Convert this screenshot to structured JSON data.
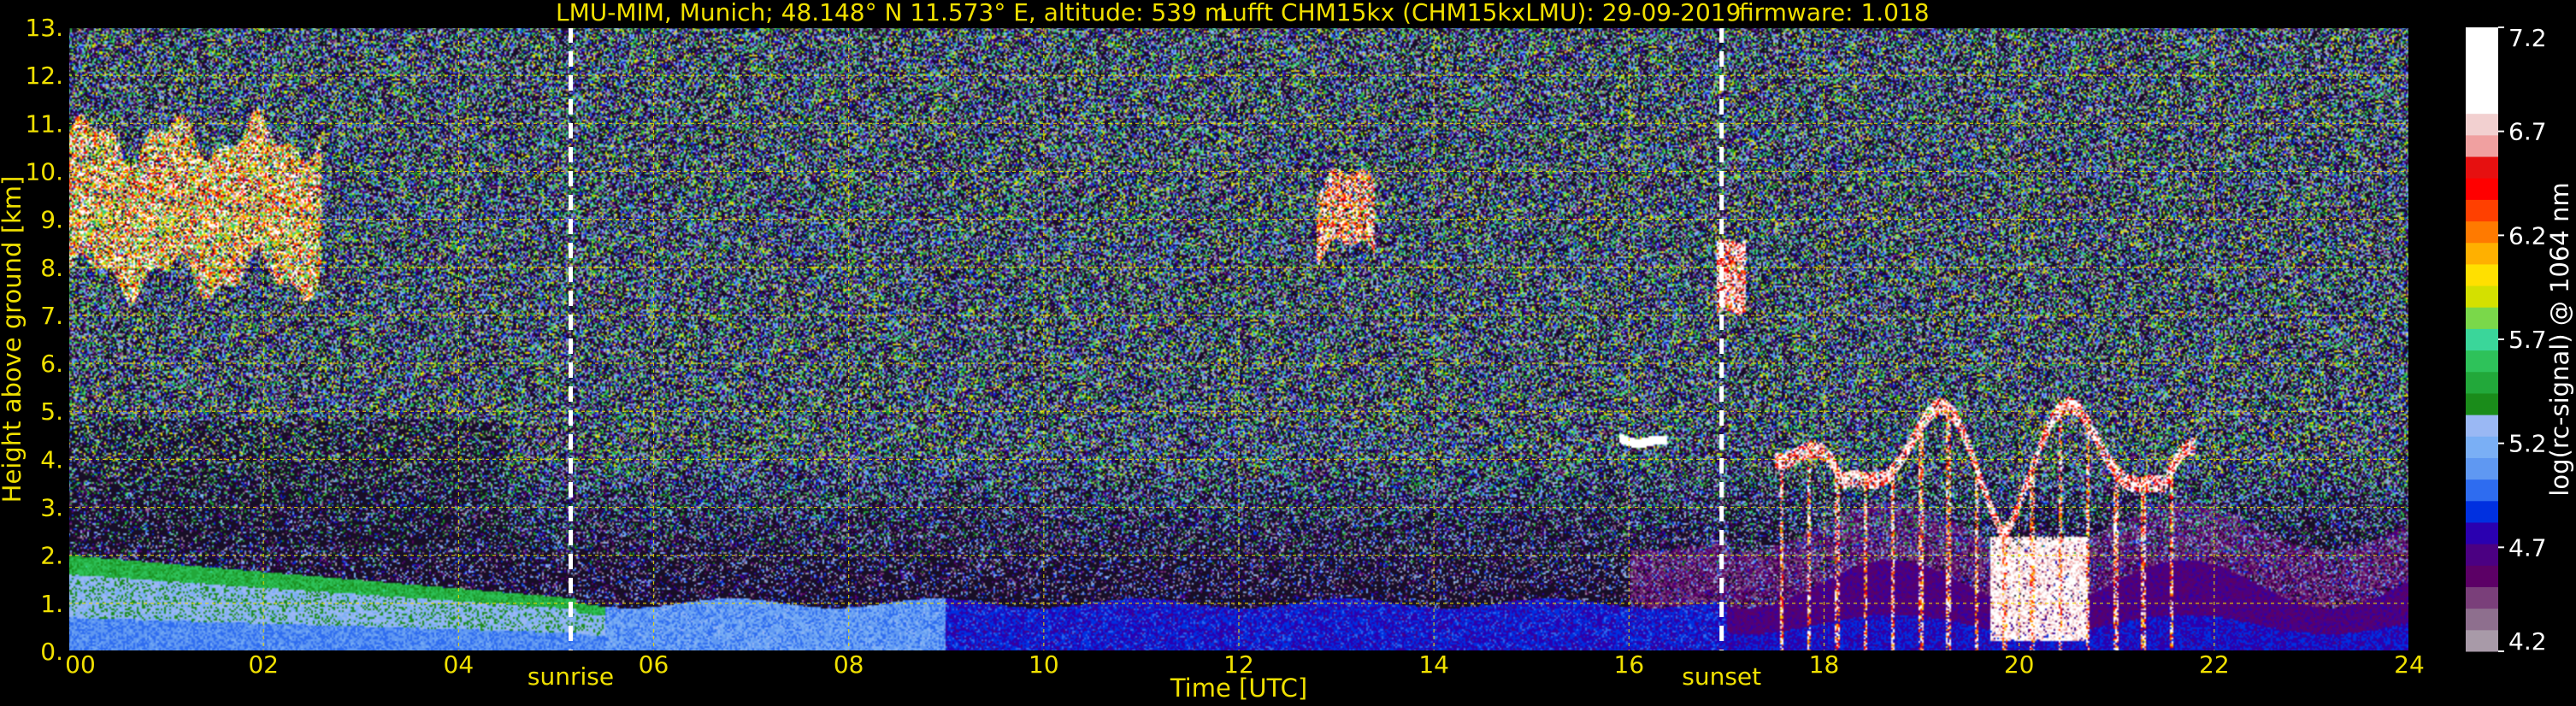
{
  "chart_data": {
    "type": "heatmap",
    "title": {
      "station": "LMU-MIM, Munich; 48.148° N 11.573° E, altitude: 539 m",
      "instrument": "Lufft CHM15kx (CHM15kxLMU): 29-09-2019",
      "firmware": "firmware: 1.018"
    },
    "xlabel": "Time [UTC]",
    "ylabel": "Height above ground [km]",
    "xlim": [
      0,
      24
    ],
    "ylim": [
      0,
      13
    ],
    "xticks": [
      {
        "value": 0,
        "label": "00"
      },
      {
        "value": 2,
        "label": "02"
      },
      {
        "value": 4,
        "label": "04"
      },
      {
        "value": 6,
        "label": "06"
      },
      {
        "value": 8,
        "label": "08"
      },
      {
        "value": 10,
        "label": "10"
      },
      {
        "value": 12,
        "label": "12"
      },
      {
        "value": 14,
        "label": "14"
      },
      {
        "value": 16,
        "label": "16"
      },
      {
        "value": 18,
        "label": "18"
      },
      {
        "value": 20,
        "label": "20"
      },
      {
        "value": 22,
        "label": "22"
      },
      {
        "value": 24,
        "label": "24"
      }
    ],
    "yticks": [
      {
        "value": 0,
        "label": "0."
      },
      {
        "value": 1,
        "label": "1."
      },
      {
        "value": 2,
        "label": "2."
      },
      {
        "value": 3,
        "label": "3."
      },
      {
        "value": 4,
        "label": "4."
      },
      {
        "value": 5,
        "label": "5."
      },
      {
        "value": 6,
        "label": "6."
      },
      {
        "value": 7,
        "label": "7."
      },
      {
        "value": 8,
        "label": "8."
      },
      {
        "value": 9,
        "label": "9."
      },
      {
        "value": 10,
        "label": "10."
      },
      {
        "value": 11,
        "label": "11."
      },
      {
        "value": 12,
        "label": "12."
      },
      {
        "value": 13,
        "label": "13."
      }
    ],
    "grid": true,
    "grid_color": "#f0e000",
    "events": [
      {
        "name": "sunrise",
        "time": 5.15
      },
      {
        "name": "sunset",
        "time": 16.95
      }
    ],
    "colorbar": {
      "label": "log(rc-signal) @ 1064 nm",
      "range": [
        4.2,
        7.2
      ],
      "ticks": [
        {
          "value": 4.2,
          "label": "4.2"
        },
        {
          "value": 4.7,
          "label": "4.7"
        },
        {
          "value": 5.2,
          "label": "5.2"
        },
        {
          "value": 5.7,
          "label": "5.7"
        },
        {
          "value": 6.2,
          "label": "6.2"
        },
        {
          "value": 6.7,
          "label": "6.7"
        },
        {
          "value": 7.2,
          "label": "7.2"
        }
      ],
      "colors": [
        "#a89aa8",
        "#8e6f8e",
        "#7a3f7a",
        "#5c0066",
        "#4b0082",
        "#2a00b0",
        "#0030e0",
        "#2e6cf0",
        "#5f98f2",
        "#7aaff5",
        "#9ab8f4",
        "#1a8c1a",
        "#22a83a",
        "#2ec25a",
        "#3ad69a",
        "#7ad84a",
        "#d4e000",
        "#ffe000",
        "#ffb000",
        "#ff7a00",
        "#ff4000",
        "#ff0000",
        "#e61010",
        "#f0a0a0",
        "#f2d0d0",
        "#ffffff",
        "#ffffff",
        "#ffffff",
        "#ffffff"
      ]
    },
    "layers": [
      {
        "name": "background-noise",
        "description_value": 4.5
      },
      {
        "name": "boundary-layer-morning",
        "t_start": 0,
        "t_end": 5.2,
        "top_km": 2.0,
        "values_range": [
          4.8,
          5.4
        ]
      },
      {
        "name": "residual-layer",
        "t_start": 5.2,
        "t_end": 24,
        "top_km": 1.0,
        "values_range": [
          4.7,
          5.0
        ]
      },
      {
        "name": "cirrus-early",
        "t_start": 0,
        "t_end": 2.6,
        "base_km": 7.8,
        "top_km": 10.7,
        "values_range": [
          5.6,
          7.2
        ]
      },
      {
        "name": "cirrus-midday",
        "t_start": 12.8,
        "t_end": 13.4,
        "base_km": 8.3,
        "top_km": 9.8,
        "values_range": [
          6.2,
          7.2
        ]
      },
      {
        "name": "cloud-sunset",
        "t_start": 16.9,
        "t_end": 17.2,
        "base_km": 7.2,
        "top_km": 8.7,
        "values_range": [
          6.0,
          7.2
        ]
      },
      {
        "name": "mid-cloud",
        "t_start": 15.9,
        "t_end": 16.4,
        "base_km": 4.3,
        "top_km": 4.5,
        "values_range": [
          6.5,
          7.2
        ]
      },
      {
        "name": "evening-clouds",
        "t_start": 17.5,
        "t_end": 21.8,
        "base_km": 0.0,
        "top_km": 5.4,
        "values_range": [
          5.6,
          7.2
        ]
      }
    ]
  }
}
